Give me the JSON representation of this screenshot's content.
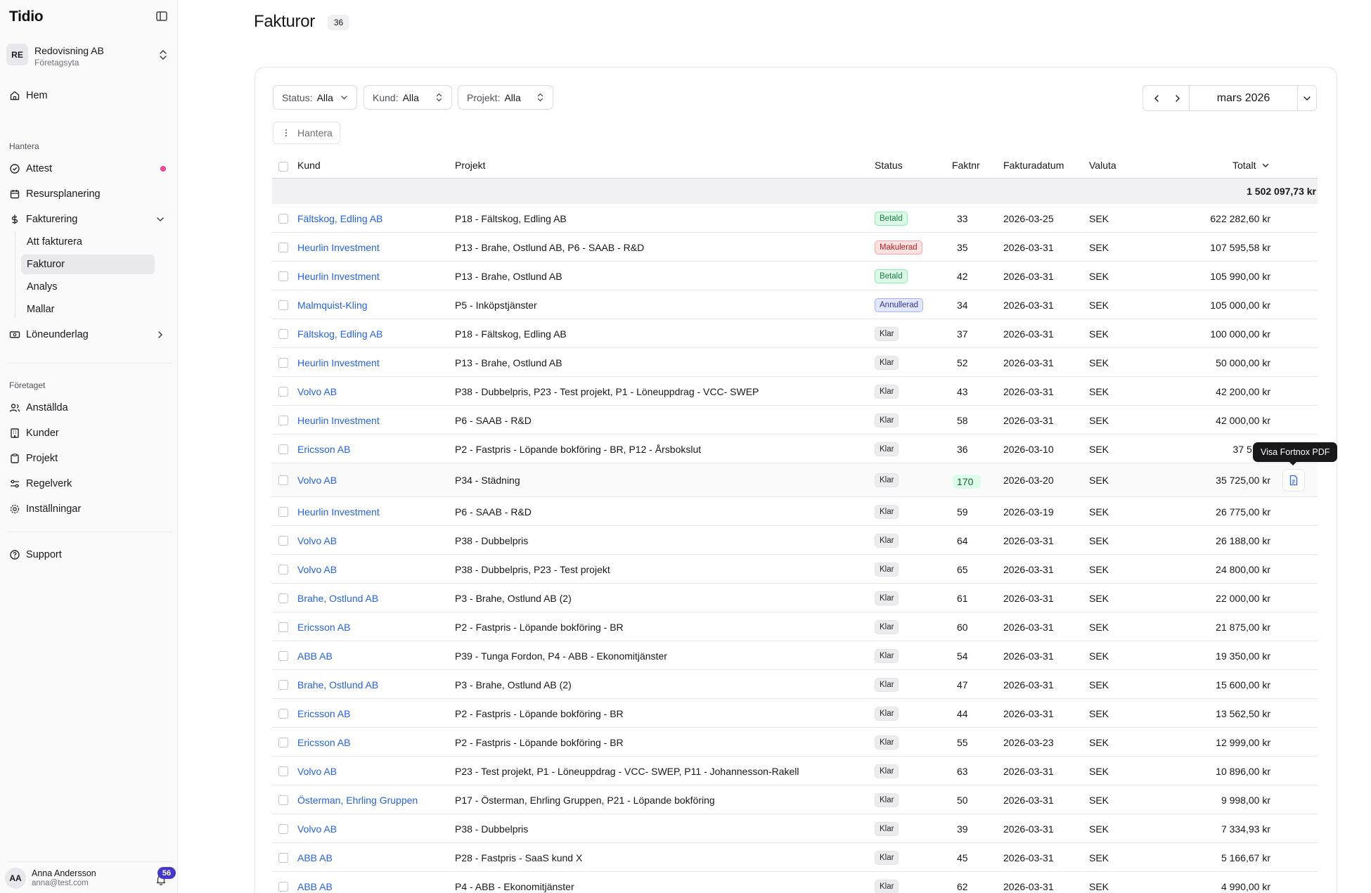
{
  "app": {
    "brand": "Tidio"
  },
  "company": {
    "initials": "RE",
    "name": "Redovisning AB",
    "type": "Företagsyta"
  },
  "nav": {
    "home": "Hem",
    "section_manage": "Hantera",
    "attest": "Attest",
    "resource_planning": "Resursplanering",
    "invoicing": "Fakturering",
    "invoicing_sub": [
      "Att fakturera",
      "Fakturor",
      "Analys",
      "Mallar"
    ],
    "payroll": "Löneunderlag",
    "section_company": "Företaget",
    "employees": "Anställda",
    "customers": "Kunder",
    "projects": "Projekt",
    "rules": "Regelverk",
    "settings": "Inställningar",
    "support": "Support"
  },
  "user": {
    "initials": "AA",
    "name": "Anna Andersson",
    "email": "anna@test.com",
    "notifications": "56"
  },
  "page": {
    "title": "Fakturor",
    "count": "36"
  },
  "filters": {
    "status_label": "Status:",
    "status_value": "Alla",
    "kund_label": "Kund:",
    "kund_value": "Alla",
    "projekt_label": "Projekt:",
    "projekt_value": "Alla"
  },
  "month": "mars 2026",
  "manage_label": "Hantera",
  "table": {
    "headers": {
      "kund": "Kund",
      "projekt": "Projekt",
      "status": "Status",
      "faktnr": "Faktnr",
      "fakturadatum": "Fakturadatum",
      "valuta": "Valuta",
      "totalt": "Totalt"
    },
    "sum_total": "1 502 097,73 kr",
    "rows": [
      {
        "kund": "Fältskog, Edling AB",
        "projekt": "P18 - Fältskog, Edling AB",
        "status": "Betald",
        "faktnr": "33",
        "datum": "2026-03-25",
        "valuta": "SEK",
        "totalt": "622 282,60 kr"
      },
      {
        "kund": "Heurlin Investment",
        "projekt": "P13 - Brahe, Ostlund AB, P6 - SAAB - R&D",
        "status": "Makulerad",
        "faktnr": "35",
        "datum": "2026-03-31",
        "valuta": "SEK",
        "totalt": "107 595,58 kr"
      },
      {
        "kund": "Heurlin Investment",
        "projekt": "P13 - Brahe, Ostlund AB",
        "status": "Betald",
        "faktnr": "42",
        "datum": "2026-03-31",
        "valuta": "SEK",
        "totalt": "105 990,00 kr"
      },
      {
        "kund": "Malmquist-Kling",
        "projekt": "P5 - Inköpstjänster",
        "status": "Annullerad",
        "faktnr": "34",
        "datum": "2026-03-31",
        "valuta": "SEK",
        "totalt": "105 000,00 kr"
      },
      {
        "kund": "Fältskog, Edling AB",
        "projekt": "P18 - Fältskog, Edling AB",
        "status": "Klar",
        "faktnr": "37",
        "datum": "2026-03-31",
        "valuta": "SEK",
        "totalt": "100 000,00 kr"
      },
      {
        "kund": "Heurlin Investment",
        "projekt": "P13 - Brahe, Ostlund AB",
        "status": "Klar",
        "faktnr": "52",
        "datum": "2026-03-31",
        "valuta": "SEK",
        "totalt": "50 000,00 kr"
      },
      {
        "kund": "Volvo AB",
        "projekt": "P38 - Dubbelpris, P23 - Test projekt, P1 - Löneuppdrag - VCC- SWEP",
        "status": "Klar",
        "faktnr": "43",
        "datum": "2026-03-31",
        "valuta": "SEK",
        "totalt": "42 200,00 kr"
      },
      {
        "kund": "Heurlin Investment",
        "projekt": "P6 - SAAB - R&D",
        "status": "Klar",
        "faktnr": "58",
        "datum": "2026-03-31",
        "valuta": "SEK",
        "totalt": "42 000,00 kr"
      },
      {
        "kund": "Ericsson AB",
        "projekt": "P2 - Fastpris - Löpande bokföring - BR, P12 - Årsbokslut",
        "status": "Klar",
        "faktnr": "36",
        "datum": "2026-03-10",
        "valuta": "SEK",
        "totalt": "37 511,9"
      },
      {
        "kund": "Volvo AB",
        "projekt": "P34 - Städning",
        "status": "Klar",
        "faktnr": "170",
        "datum": "2026-03-20",
        "valuta": "SEK",
        "totalt": "35 725,00 kr"
      },
      {
        "kund": "Heurlin Investment",
        "projekt": "P6 - SAAB - R&D",
        "status": "Klar",
        "faktnr": "59",
        "datum": "2026-03-19",
        "valuta": "SEK",
        "totalt": "26 775,00 kr"
      },
      {
        "kund": "Volvo AB",
        "projekt": "P38 - Dubbelpris",
        "status": "Klar",
        "faktnr": "64",
        "datum": "2026-03-31",
        "valuta": "SEK",
        "totalt": "26 188,00 kr"
      },
      {
        "kund": "Volvo AB",
        "projekt": "P38 - Dubbelpris, P23 - Test projekt",
        "status": "Klar",
        "faktnr": "65",
        "datum": "2026-03-31",
        "valuta": "SEK",
        "totalt": "24 800,00 kr"
      },
      {
        "kund": "Brahe, Ostlund AB",
        "projekt": "P3 - Brahe, Ostlund AB (2)",
        "status": "Klar",
        "faktnr": "61",
        "datum": "2026-03-31",
        "valuta": "SEK",
        "totalt": "22 000,00 kr"
      },
      {
        "kund": "Ericsson AB",
        "projekt": "P2 - Fastpris - Löpande bokföring - BR",
        "status": "Klar",
        "faktnr": "60",
        "datum": "2026-03-31",
        "valuta": "SEK",
        "totalt": "21 875,00 kr"
      },
      {
        "kund": "ABB AB",
        "projekt": "P39 - Tunga Fordon, P4 - ABB - Ekonomitjänster",
        "status": "Klar",
        "faktnr": "54",
        "datum": "2026-03-31",
        "valuta": "SEK",
        "totalt": "19 350,00 kr"
      },
      {
        "kund": "Brahe, Ostlund AB",
        "projekt": "P3 - Brahe, Ostlund AB (2)",
        "status": "Klar",
        "faktnr": "47",
        "datum": "2026-03-31",
        "valuta": "SEK",
        "totalt": "15 600,00 kr"
      },
      {
        "kund": "Ericsson AB",
        "projekt": "P2 - Fastpris - Löpande bokföring - BR",
        "status": "Klar",
        "faktnr": "44",
        "datum": "2026-03-31",
        "valuta": "SEK",
        "totalt": "13 562,50 kr"
      },
      {
        "kund": "Ericsson AB",
        "projekt": "P2 - Fastpris - Löpande bokföring - BR",
        "status": "Klar",
        "faktnr": "55",
        "datum": "2026-03-23",
        "valuta": "SEK",
        "totalt": "12 999,00 kr"
      },
      {
        "kund": "Volvo AB",
        "projekt": "P23 - Test projekt, P1 - Löneuppdrag - VCC- SWEP, P11 - Johannesson-Rakell",
        "status": "Klar",
        "faktnr": "63",
        "datum": "2026-03-31",
        "valuta": "SEK",
        "totalt": "10 896,00 kr"
      },
      {
        "kund": "Österman, Ehrling Gruppen",
        "projekt": "P17 - Österman, Ehrling Gruppen, P21 - Löpande bokföring",
        "status": "Klar",
        "faktnr": "50",
        "datum": "2026-03-31",
        "valuta": "SEK",
        "totalt": "9 998,00 kr"
      },
      {
        "kund": "Volvo AB",
        "projekt": "P38 - Dubbelpris",
        "status": "Klar",
        "faktnr": "39",
        "datum": "2026-03-31",
        "valuta": "SEK",
        "totalt": "7 334,93 kr"
      },
      {
        "kund": "ABB AB",
        "projekt": "P28 - Fastpris - SaaS kund X",
        "status": "Klar",
        "faktnr": "45",
        "datum": "2026-03-31",
        "valuta": "SEK",
        "totalt": "5 166,67 kr"
      },
      {
        "kund": "ABB AB",
        "projekt": "P4 - ABB - Ekonomitjänster",
        "status": "Klar",
        "faktnr": "62",
        "datum": "2026-03-31",
        "valuta": "SEK",
        "totalt": "4 990,00 kr"
      }
    ]
  },
  "tooltip": "Visa Fortnox PDF",
  "hovered_row_index": 9,
  "colors": {
    "link": "#2563eb",
    "accent_dot": "#ec4899",
    "badge": "#4338ca"
  },
  "icons": [
    "panel-toggle-icon",
    "updown-icon",
    "home-icon",
    "check-circle-icon",
    "calendar-icon",
    "dollar-icon",
    "chevron-down-icon",
    "chevron-right-icon",
    "payroll-icon",
    "users-icon",
    "building-icon",
    "clipboard-icon",
    "sliders-icon",
    "gear-icon",
    "help-circle-icon",
    "bell-icon",
    "file-pdf-icon"
  ]
}
